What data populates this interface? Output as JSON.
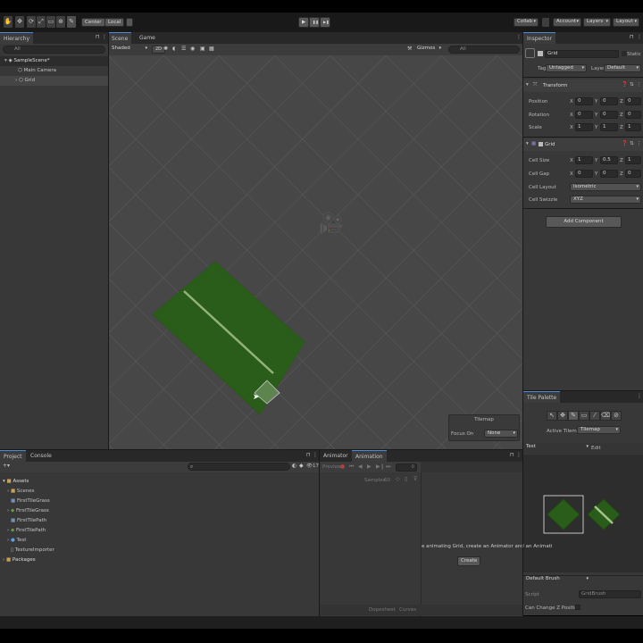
{
  "toolbar": {
    "tools": [
      "✋",
      "✥",
      "⟳",
      "⤢",
      "▭",
      "⊕",
      "✎"
    ],
    "center_label": "Center",
    "local_label": "Local",
    "play": "▶",
    "pause": "❚❚",
    "step": "▶❚",
    "collab_label": "Collab",
    "account_label": "Account",
    "layers_label": "Layers",
    "layout_label": "Layout"
  },
  "hierarchy": {
    "tab_label": "Hierarchy",
    "search_placeholder": "All",
    "scene_name": "SampleScene*",
    "items": [
      "Main Camera",
      "Grid"
    ]
  },
  "scene_view": {
    "tabs": [
      "Scene",
      "Game"
    ],
    "shading_mode": "Shaded",
    "mode_2d": "2D",
    "gizmos_label": "Gizmos",
    "search_placeholder": "All",
    "overlay": {
      "title": "Tilemap",
      "focus_on_label": "Focus On",
      "focus_on_value": "None"
    }
  },
  "inspector": {
    "tab_label": "Inspector",
    "object_name": "Grid",
    "static_label": "Static",
    "tag_label": "Tag",
    "tag_value": "Untagged",
    "layer_label": "Layer",
    "layer_value": "Default",
    "transform": {
      "title": "Transform",
      "position_label": "Position",
      "rotation_label": "Rotation",
      "scale_label": "Scale",
      "position": [
        "0",
        "0",
        "0"
      ],
      "rotation": [
        "0",
        "0",
        "0"
      ],
      "scale": [
        "1",
        "1",
        "1"
      ]
    },
    "grid": {
      "title": "Grid",
      "cell_size_label": "Cell Size",
      "cell_gap_label": "Cell Gap",
      "cell_layout_label": "Cell Layout",
      "cell_swizzle_label": "Cell Swizzle",
      "cell_size": [
        "1",
        "0.5",
        "1"
      ],
      "cell_gap": [
        "0",
        "0",
        "0"
      ],
      "cell_layout": "Isometric",
      "cell_swizzle": "XYZ"
    },
    "add_component_label": "Add Component",
    "axis_labels": [
      "X",
      "Y",
      "Z"
    ]
  },
  "tile_palette": {
    "tab_label": "Tile Palette",
    "active_tilemap_label": "Active Tilemap",
    "active_tilemap_value": "Tilemap",
    "palette_name": "Test",
    "edit_label": "Edit",
    "brush_name": "Default Brush",
    "script_label": "Script",
    "script_value": "GridBrush",
    "can_change_z_label": "Can Change Z Position"
  },
  "project": {
    "tabs": [
      "Project",
      "Console"
    ],
    "item_count": "17",
    "tree": [
      {
        "label": "Assets",
        "level": 0,
        "icon": "folder-icon"
      },
      {
        "label": "Scenes",
        "level": 1,
        "icon": "folder-icon"
      },
      {
        "label": "FirstTileGrass",
        "level": 1,
        "icon": "tile-icon"
      },
      {
        "label": "FirstTileGrass",
        "level": 1,
        "icon": "sprite-icon"
      },
      {
        "label": "FirstTilePath",
        "level": 1,
        "icon": "tile-icon"
      },
      {
        "label": "FirstTilePath",
        "level": 1,
        "icon": "sprite-icon"
      },
      {
        "label": "Test",
        "level": 1,
        "icon": "prefab-icon"
      },
      {
        "label": "TextureImporter",
        "level": 1,
        "icon": "asset-icon"
      },
      {
        "label": "Packages",
        "level": 0,
        "icon": "folder-icon"
      }
    ]
  },
  "animation": {
    "tabs": [
      "Animator",
      "Animation"
    ],
    "preview_label": "Preview",
    "samples_label": "Samples",
    "samples_value": "60",
    "frame_value": "0",
    "message": "e animating Grid, create an Animator and an Animati",
    "create_label": "Create",
    "dopesheet_label": "Dopesheet",
    "curves_label": "Curves"
  }
}
